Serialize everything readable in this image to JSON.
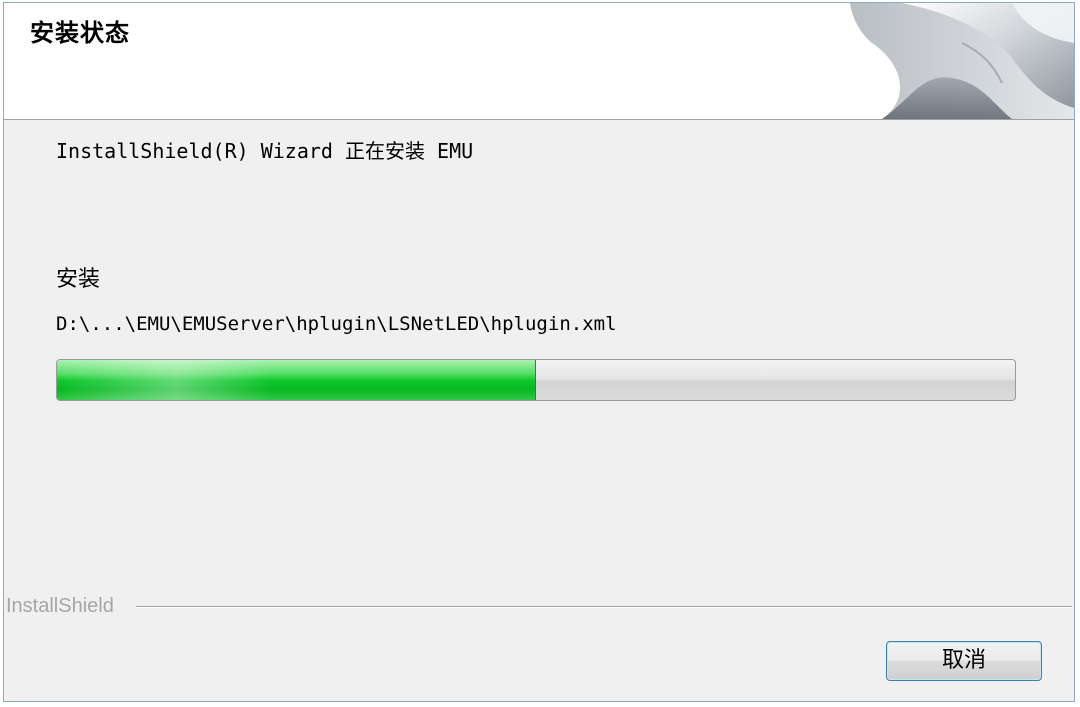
{
  "header": {
    "title": "安装状态",
    "graphic_icon": "installshield-page-curl-graphic"
  },
  "main": {
    "status_text": "InstallShield(R) Wizard 正在安装 EMU",
    "action_label": "安装",
    "file_path": "D:\\...\\EMU\\EMUServer\\hplugin\\LSNetLED\\hplugin.xml",
    "progress": 0.5
  },
  "footer": {
    "brand": "InstallShield",
    "cancel_label": "取消"
  },
  "colors": {
    "progress_green": "#0cc72a",
    "button_border": "#3c7fb1",
    "brand_text": "#a6a6a6"
  }
}
